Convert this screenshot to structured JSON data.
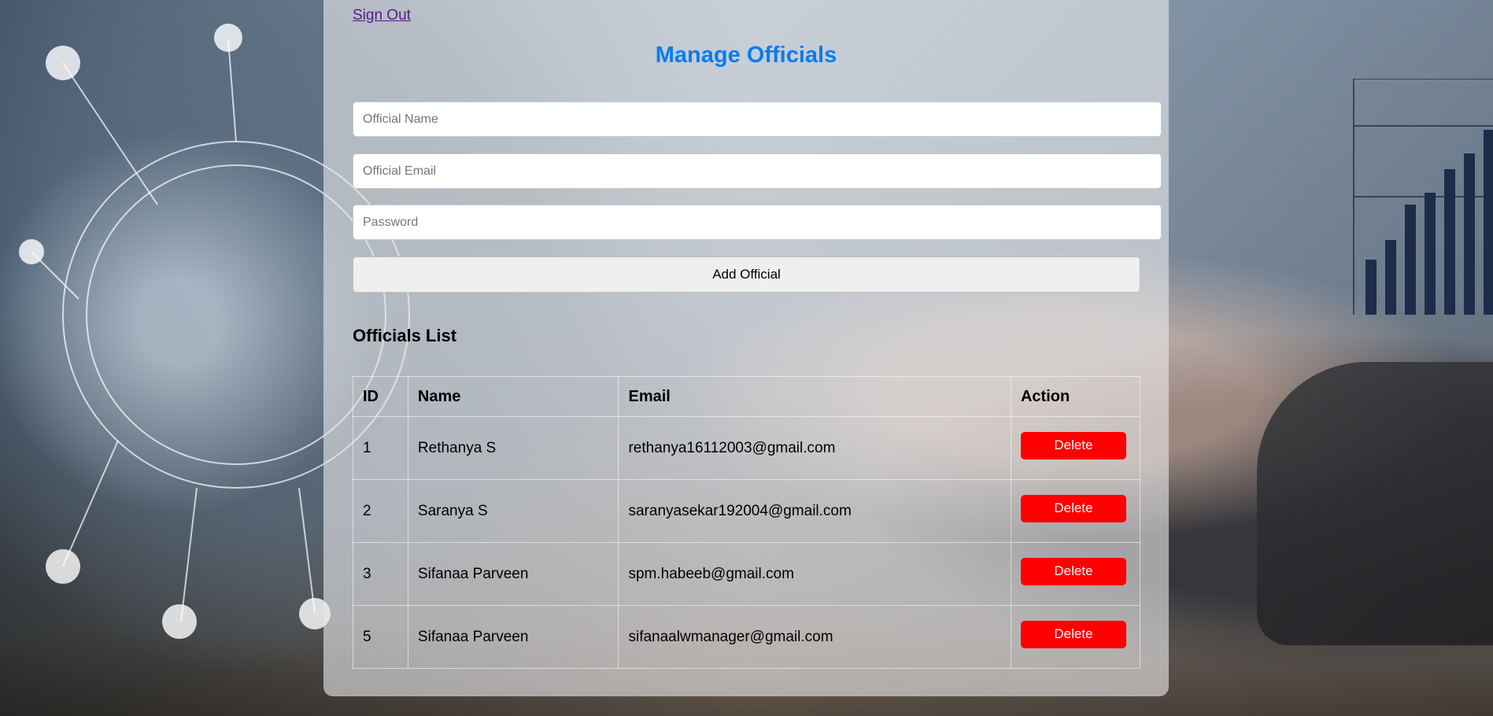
{
  "header": {
    "sign_out": "Sign Out",
    "title": "Manage Officials"
  },
  "form": {
    "name_placeholder": "Official Name",
    "email_placeholder": "Official Email",
    "password_placeholder": "Password",
    "add_button": "Add Official"
  },
  "list": {
    "title": "Officials List",
    "columns": [
      "ID",
      "Name",
      "Email",
      "Action"
    ],
    "rows": [
      {
        "id": "1",
        "name": "Rethanya S",
        "email": "rethanya16112003@gmail.com",
        "action": "Delete"
      },
      {
        "id": "2",
        "name": "Saranya S",
        "email": "saranyasekar192004@gmail.com",
        "action": "Delete"
      },
      {
        "id": "3",
        "name": "Sifanaa Parveen",
        "email": "spm.habeeb@gmail.com",
        "action": "Delete"
      },
      {
        "id": "5",
        "name": "Sifanaa Parveen",
        "email": "sifanaalwmanager@gmail.com",
        "action": "Delete"
      }
    ]
  },
  "colors": {
    "title": "#0a7cf0",
    "delete": "#ff0000",
    "link": "#551a8b"
  }
}
